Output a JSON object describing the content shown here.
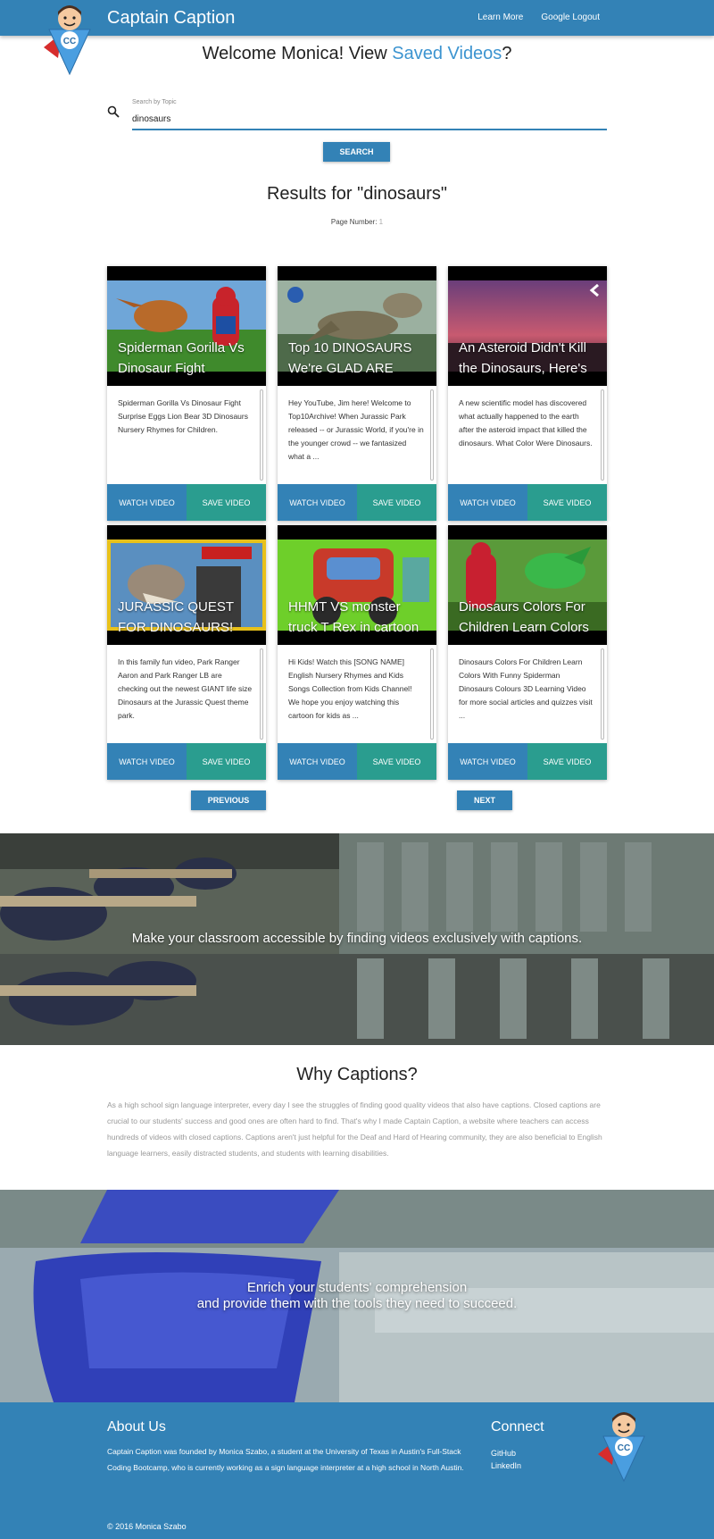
{
  "nav": {
    "brand": "Captain Caption",
    "learn_more": "Learn More",
    "logout": "Google Logout",
    "logo_badge": "CC"
  },
  "welcome": {
    "prefix": "Welcome Monica! View ",
    "link": "Saved Videos",
    "suffix": "?"
  },
  "search": {
    "label": "Search by Topic",
    "value": "dinosaurs",
    "button": "SEARCH"
  },
  "results": {
    "title": "Results for \"dinosaurs\"",
    "page_label": "Page Number: ",
    "page_number": "1"
  },
  "cards": [
    {
      "title": "Spiderman Gorilla Vs Dinosaur Fight",
      "description": "Spiderman Gorilla Vs Dinosaur Fight Surprise Eggs Lion Bear 3D Dinosaurs Nursery Rhymes for Children.",
      "watch": "WATCH VIDEO",
      "save": "SAVE VIDEO"
    },
    {
      "title": "Top 10 DINOSAURS We're GLAD ARE",
      "description": "Hey YouTube, Jim here! Welcome to Top10Archive! When Jurassic Park released -- or Jurassic World, if you're in the younger crowd -- we fantasized what a ...",
      "watch": "WATCH VIDEO",
      "save": "SAVE VIDEO"
    },
    {
      "title": "An Asteroid Didn't Kill the Dinosaurs, Here's",
      "description": "A new scientific model has discovered what actually happened to the earth after the asteroid impact that killed the dinosaurs. What Color Were Dinosaurs.",
      "watch": "WATCH VIDEO",
      "save": "SAVE VIDEO"
    },
    {
      "title": "JURASSIC QUEST FOR DINOSAURS!",
      "description": "In this family fun video, Park Ranger Aaron and Park Ranger LB are checking out the newest GIANT life size Dinosaurs at the Jurassic Quest theme park.",
      "watch": "WATCH VIDEO",
      "save": "SAVE VIDEO"
    },
    {
      "title": "HHMT VS monster truck T Rex in cartoon",
      "description": "Hi Kids! Watch this [SONG NAME] English Nursery Rhymes and Kids Songs Collection from Kids Channel! We hope you enjoy watching this cartoon for kids as ...",
      "watch": "WATCH VIDEO",
      "save": "SAVE VIDEO"
    },
    {
      "title": "Dinosaurs Colors For Children Learn Colors",
      "description": "Dinosaurs Colors For Children Learn Colors With Funny Spiderman Dinosaurs Colours 3D Learning Video for more social articles and quizzes visit ...",
      "watch": "WATCH VIDEO",
      "save": "SAVE VIDEO"
    }
  ],
  "pager": {
    "previous": "PREVIOUS",
    "next": "NEXT"
  },
  "banner1": {
    "text": "Make your classroom accessible by finding videos exclusively with captions."
  },
  "why": {
    "title": "Why Captions?",
    "text": "As a high school sign language interpreter, every day I see the struggles of finding good quality videos that also have captions. Closed captions are crucial to our students' success and good ones are often hard to find. That's why I made Captain Caption, a website where teachers can access hundreds of videos with closed captions. Captions aren't just helpful for the Deaf and Hard of Hearing community, they are also beneficial to English language learners, easily distracted students, and students with learning disabilities."
  },
  "banner2": {
    "line1": "Enrich your students' comprehension",
    "line2": "and provide them with the tools they need to succeed."
  },
  "footer": {
    "about_title": "About Us",
    "about_text": "Captain Caption was founded by Monica Szabo, a student at the University of Texas in Austin's Full-Stack Coding Bootcamp, who is currently working as a sign language interpreter at a high school in North Austin.",
    "connect_title": "Connect",
    "github": "GitHub",
    "linkedin": "LinkedIn",
    "copyright": "© 2016 Monica Szabo"
  },
  "colors": {
    "primary": "#3382b6",
    "teal": "#2a9d8f",
    "link": "#3c94d0"
  }
}
